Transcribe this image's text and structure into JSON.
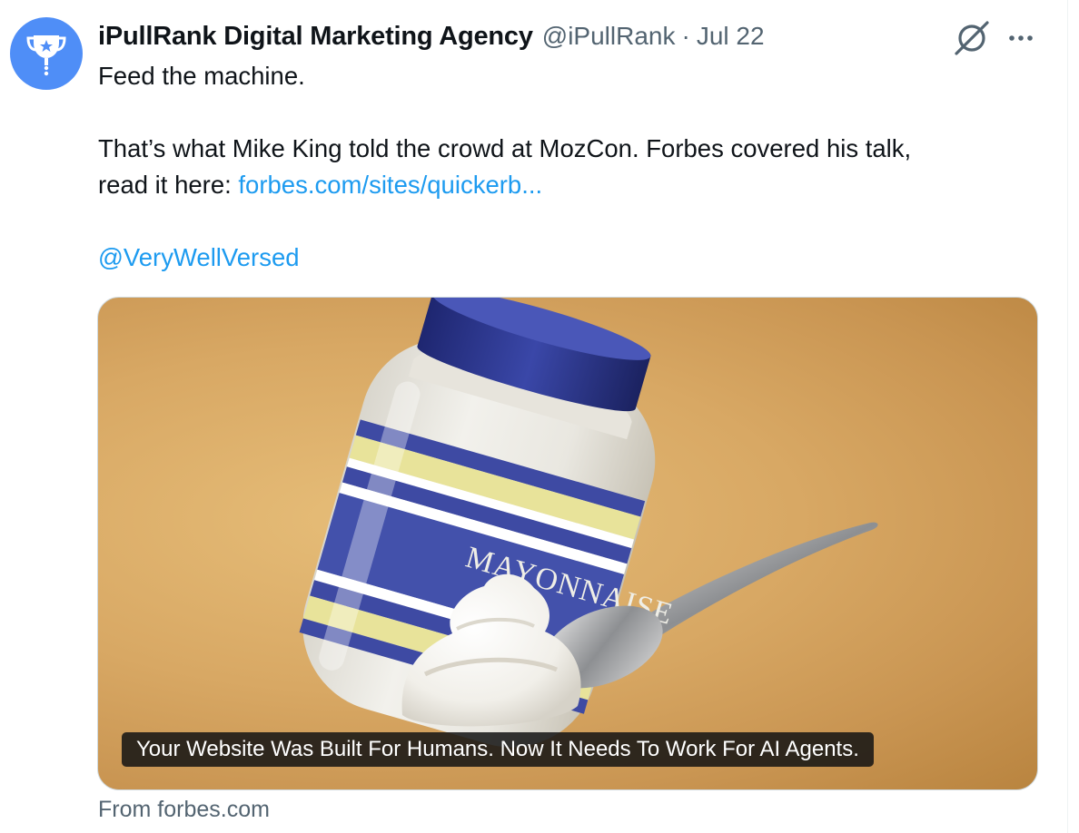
{
  "tweet": {
    "author_name": "iPullRank Digital Marketing Agency",
    "handle": "@iPullRank",
    "separator": "·",
    "date": "Jul 22",
    "line1": "Feed the machine.",
    "line2a": "That’s what Mike King told the crowd at MozCon. Forbes covered his talk,",
    "line2b_prefix": "read it here: ",
    "link_text": "forbes.com/sites/quickerb...",
    "mention": "@VeryWellVersed"
  },
  "card": {
    "jar_label": "MAYONNAISE",
    "headline": "Your Website Was Built For Humans. Now It Needs To Work For AI Agents.",
    "source": "From forbes.com"
  },
  "icons": {
    "avatar": "trophy-icon",
    "grok": "grok-icon",
    "more": "more-dots-icon"
  },
  "colors": {
    "link": "#1d9bf0",
    "avatar_bg": "#4f8ef7",
    "jar_lid": "#2b3485",
    "jar_stripe_blue": "#3e4aa3",
    "jar_stripe_yellow": "#e8e39a"
  }
}
